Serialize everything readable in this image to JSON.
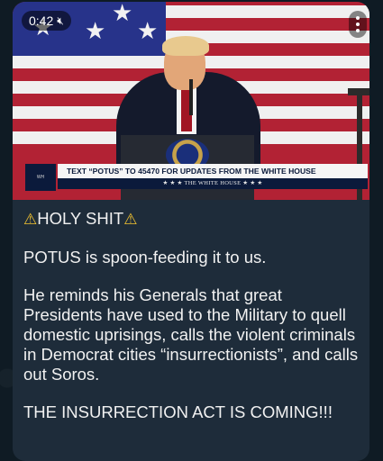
{
  "video": {
    "timer": "0:42",
    "mute_icon": "speaker-muted-icon",
    "lower_third_main": "TEXT “POTUS” TO 45470 FOR UPDATES FROM THE WHITE HOUSE",
    "lower_third_sub": "★ ★ ★  THE WHITE HOUSE  ★ ★ ★"
  },
  "message": {
    "heading_warn_icon": "⚠",
    "heading": "HOLY SHIT",
    "para1": "POTUS is spoon-feeding it to us.",
    "para2": "He reminds his Generals that great Presidents have used to the Military to quell domestic uprisings, calls the violent criminals in Democrat cities “insurrectionists”, and calls out Soros.",
    "para3": "THE INSURRECTION ACT IS COMING!!!"
  },
  "colors": {
    "bubble": "#1e2c3a",
    "text": "#f1f1f1",
    "warning": "#f2c230"
  }
}
